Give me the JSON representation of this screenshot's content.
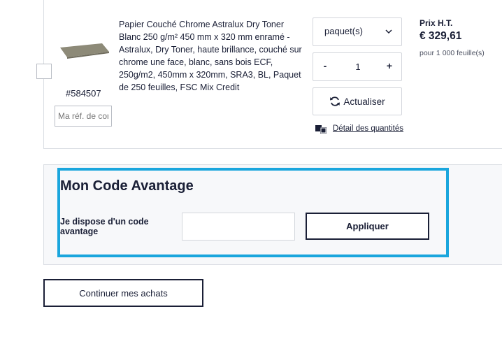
{
  "product": {
    "sku": "#584507",
    "reference_placeholder": "Ma réf. de cor",
    "description": "Papier Couché Chrome Astralux Dry Toner Blanc 250 g/m² 450 mm x 320 mm enramé - Astralux, Dry Toner, haute brillance, couché sur chrome une face, blanc, sans bois ECF, 250g/m2, 450mm x 320mm, SRA3, BL, Paquet de 250 feuilles, FSC Mix Credit",
    "unit_select_value": "paquet(s)",
    "quantity": "1",
    "qty_minus": "-",
    "qty_plus": "+",
    "refresh_label": "Actualiser",
    "detail_link": "Détail des quantités",
    "price_label": "Prix H.T.",
    "price": "€ 329,61",
    "price_sub": "pour 1 000 feuille(s)"
  },
  "promo": {
    "title": "Mon Code Avantage",
    "label": "Je dispose d'un code avantage",
    "input_value": "",
    "apply_label": "Appliquer"
  },
  "continue_label": "Continuer mes achats",
  "colors": {
    "highlight": "#1aa6dd",
    "text": "#1a1f36",
    "promo_bg": "#f7f8fa"
  }
}
